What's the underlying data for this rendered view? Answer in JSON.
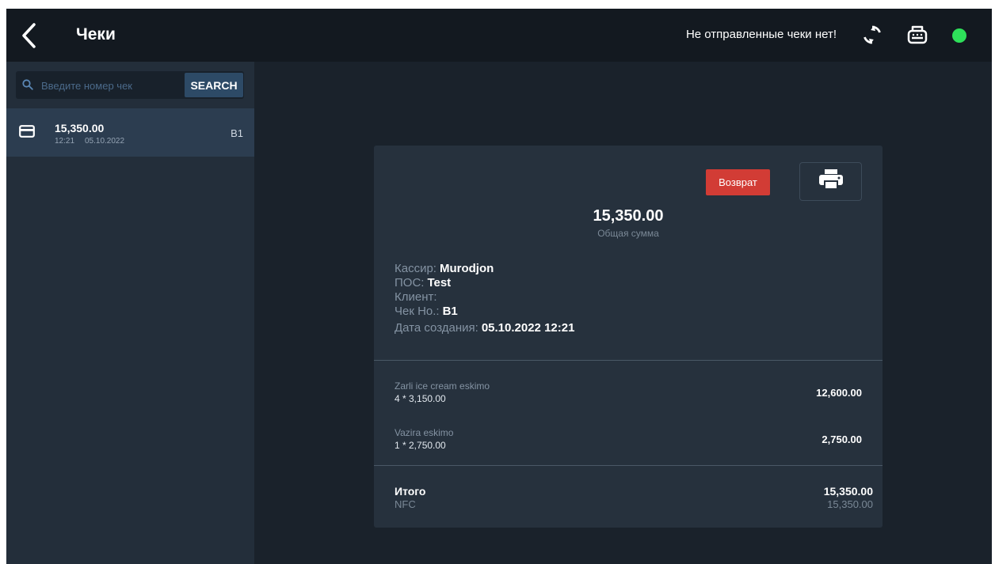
{
  "header": {
    "title": "Чеки",
    "status_text": "Не отправленные чеки нет!",
    "status_color": "#2ee05a",
    "icons": [
      "back-icon",
      "sync-icon",
      "printer-icon",
      "status-dot"
    ]
  },
  "sidebar": {
    "search": {
      "placeholder": "Введите номер чек",
      "button_label": "SEARCH"
    },
    "items": [
      {
        "amount": "15,350.00",
        "time": "12:21",
        "date": "05.10.2022",
        "number": "B1",
        "icon": "card-icon"
      }
    ]
  },
  "receipt": {
    "return_label": "Возврат",
    "return_color": "#d23c35",
    "total": "15,350.00",
    "total_caption": "Общая сумма",
    "info": [
      {
        "label": "Кассир:",
        "value": "Murodjon"
      },
      {
        "label": "ПОС:",
        "value": "Test"
      },
      {
        "label": "Клиент:",
        "value": ""
      },
      {
        "label": "Чек Но.:",
        "value": "B1"
      },
      {
        "label": "Дата создания:",
        "value": "05.10.2022 12:21"
      }
    ],
    "items": [
      {
        "name": "Zarli ice cream eskimo",
        "qty": "4 * 3,150.00",
        "total": "12,600.00"
      },
      {
        "name": "Vazira eskimo",
        "qty": "1 * 2,750.00",
        "total": "2,750.00"
      }
    ],
    "summary": {
      "label": "Итого",
      "total": "15,350.00",
      "payment_method": "NFC",
      "payment_amount": "15,350.00"
    }
  }
}
